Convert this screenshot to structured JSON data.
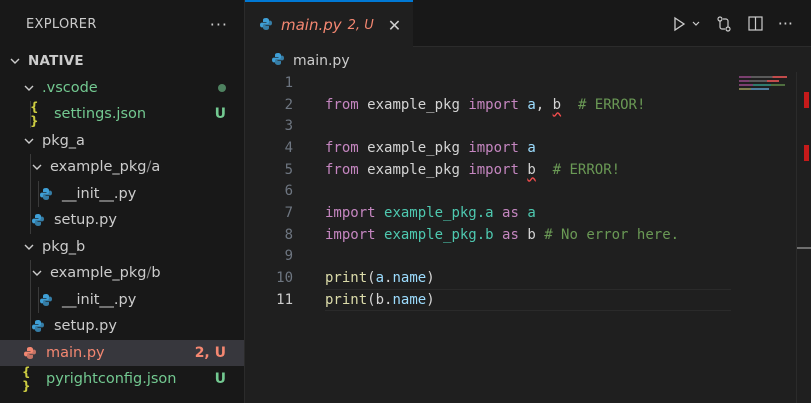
{
  "explorer": {
    "title": "EXPLORER",
    "more": "···",
    "root": "NATIVE",
    "items": [
      {
        "label": ".vscode",
        "badge": ""
      },
      {
        "label": "settings.json",
        "badge": "U"
      },
      {
        "label": "pkg_a",
        "badge": ""
      },
      {
        "label": "example_pkg",
        "sep": "/",
        "sub": "a"
      },
      {
        "label": "__init__.py",
        "badge": ""
      },
      {
        "label": "setup.py",
        "badge": ""
      },
      {
        "label": "pkg_b",
        "badge": ""
      },
      {
        "label": "example_pkg",
        "sep": "/",
        "sub": "b"
      },
      {
        "label": "__init__.py",
        "badge": ""
      },
      {
        "label": "setup.py",
        "badge": ""
      },
      {
        "label": "main.py",
        "badge": "2, U"
      },
      {
        "label": "pyrightconfig.json",
        "badge": "U"
      }
    ]
  },
  "tab": {
    "name": "main.py",
    "badge": "2, U",
    "close": "✕"
  },
  "breadcrumb": {
    "file": "main.py"
  },
  "code": {
    "line_numbers": [
      "1",
      "2",
      "3",
      "4",
      "5",
      "6",
      "7",
      "8",
      "9",
      "10",
      "11"
    ],
    "l2": {
      "kw1": "from",
      "mod": "example_pkg",
      "kw2": "import",
      "a": "a",
      "comma": ",",
      "b": "b",
      "cmt": "# ERROR!"
    },
    "l4": {
      "kw1": "from",
      "mod": "example_pkg",
      "kw2": "import",
      "a": "a"
    },
    "l5": {
      "kw1": "from",
      "mod": "example_pkg",
      "kw2": "import",
      "b": "b",
      "cmt": "# ERROR!"
    },
    "l7": {
      "kw1": "import",
      "mod": "example_pkg.a",
      "kw2": "as",
      "a": "a"
    },
    "l8": {
      "kw1": "import",
      "mod": "example_pkg.b",
      "kw2": "as",
      "b": "b",
      "cmt": "# No error here."
    },
    "l10": {
      "fn": "print",
      "open": "(",
      "obj": "a",
      "dot": ".",
      "attr": "name",
      "close": ")"
    },
    "l11": {
      "fn": "print",
      "open": "(",
      "obj": "b",
      "dot": ".",
      "attr": "name",
      "close": ")"
    }
  },
  "colors": {
    "accent": "#0078d4",
    "error": "#f48771",
    "untracked": "#73c991",
    "keyword": "#c586c0",
    "module": "#4ec9b0",
    "comment": "#6a9955"
  }
}
